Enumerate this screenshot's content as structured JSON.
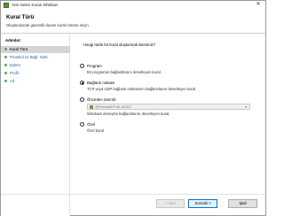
{
  "window": {
    "title": "Yeni Gelen Kuralı Sihirbazı",
    "close_glyph": "✕"
  },
  "header": {
    "title": "Kural Türü",
    "subtitle": "Oluşturulacak güvenlik duvarı kuralı türünü seçin."
  },
  "steps": {
    "title": "Adımlar:",
    "items": [
      {
        "label": "Kural Türü",
        "active": true
      },
      {
        "label": "Protokol ve Bağl. Nokt.",
        "active": false
      },
      {
        "label": "Eylem",
        "active": false
      },
      {
        "label": "Profil",
        "active": false
      },
      {
        "label": "Ad",
        "active": false
      }
    ]
  },
  "main": {
    "question": "Hangi türde bir kural oluşturmak istersiniz?",
    "options": [
      {
        "label": "Program",
        "description": "Bir programın bağlantılarını denetleyen kural.",
        "checked": false
      },
      {
        "label": "Bağlantı noktası",
        "description": "TCP veya UDP bağlantı noktasının bağlantılarını denetleyen kural.",
        "checked": true
      },
      {
        "label": "Önceden tanımlı:",
        "description": "Windows deneyimi bağlantılarını denetleyen kural.",
        "checked": false,
        "select_value": "@FirewallAPI.dll,-80200"
      },
      {
        "label": "Özel",
        "description": "Özel kural",
        "checked": false
      }
    ]
  },
  "footer": {
    "back_label": "< Geri",
    "next_label": "Sonraki >",
    "cancel_label": "İptal"
  },
  "colors": {
    "step_link": "#1c5bb5",
    "step_bullet": "#4caf50",
    "active_step_bg": "#d4d4d4",
    "primary_button_border": "#0078d7"
  },
  "icons": {
    "app": "firewall-wizard-icon",
    "predefined": "firewall-rule-icon",
    "dropdown": "chevron-down-icon"
  }
}
